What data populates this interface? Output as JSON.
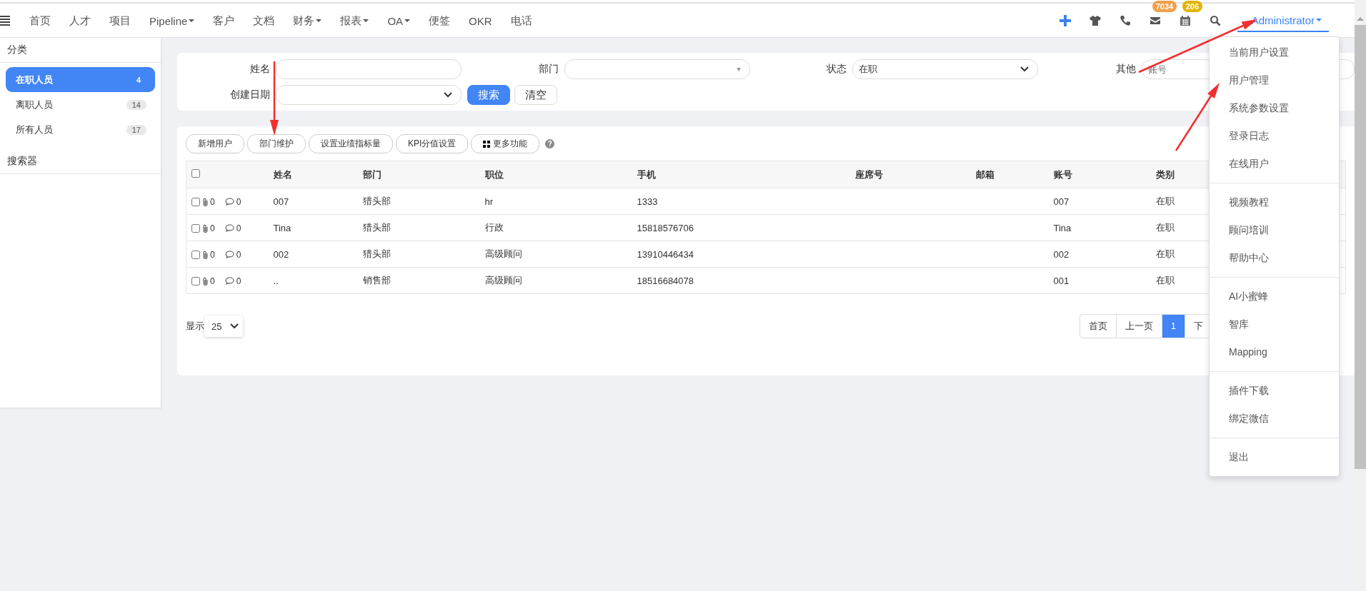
{
  "nav": {
    "items": [
      {
        "label": "首页",
        "dropdown": false
      },
      {
        "label": "人才",
        "dropdown": false
      },
      {
        "label": "项目",
        "dropdown": false
      },
      {
        "label": "Pipeline",
        "dropdown": true
      },
      {
        "label": "客户",
        "dropdown": false
      },
      {
        "label": "文档",
        "dropdown": false
      },
      {
        "label": "财务",
        "dropdown": true
      },
      {
        "label": "报表",
        "dropdown": true
      },
      {
        "label": "OA",
        "dropdown": true
      },
      {
        "label": "便签",
        "dropdown": false
      },
      {
        "label": "OKR",
        "dropdown": false
      },
      {
        "label": "电话",
        "dropdown": false
      }
    ],
    "tools": [
      {
        "kind": "plus"
      },
      {
        "kind": "shirt"
      },
      {
        "kind": "phone"
      },
      {
        "kind": "mail",
        "badge": "7034",
        "color": "#f0a04b"
      },
      {
        "kind": "calendar",
        "badge": "206",
        "color": "#e2b400"
      },
      {
        "kind": "search"
      }
    ],
    "user": {
      "label": "Administrator",
      "expanded": true
    }
  },
  "sidebar": {
    "title": "分类",
    "items": [
      {
        "label": "在职人员",
        "count": "4",
        "selected": true
      },
      {
        "label": "离职人员",
        "count": "14",
        "selected": false
      },
      {
        "label": "所有人员",
        "count": "17",
        "selected": false
      }
    ],
    "section": "搜索器"
  },
  "filters": {
    "fields": [
      {
        "label": "姓名",
        "kind": "input"
      },
      {
        "label": "部门",
        "kind": "combo"
      },
      {
        "label": "状态",
        "kind": "select",
        "value": "在职"
      },
      {
        "label": "其他",
        "kind": "input",
        "placeholder": "账号"
      },
      {
        "label": "创建日期",
        "kind": "select"
      }
    ],
    "buttons": [
      {
        "label": "搜索",
        "primary": true
      },
      {
        "label": "清空",
        "primary": false
      }
    ]
  },
  "toolbar": {
    "buttons": [
      {
        "label": "新增用户",
        "kind": "plain"
      },
      {
        "label": "部门维护",
        "kind": "plain"
      },
      {
        "label": "设置业绩指标量",
        "kind": "plain"
      },
      {
        "label": "KPI分值设置",
        "kind": "plain"
      },
      {
        "label": "更多功能",
        "kind": "grid"
      }
    ],
    "help": "?"
  },
  "table": {
    "all_checked": false,
    "columns": [
      "姓名",
      "部门",
      "职位",
      "手机",
      "座席号",
      "邮箱",
      "账号",
      "类别"
    ],
    "rows": [
      {
        "checked": false,
        "attachments": "0",
        "comments": "0",
        "cells": [
          "007",
          "猎头部",
          "hr",
          "1333",
          "",
          "",
          "007",
          "在职"
        ]
      },
      {
        "checked": false,
        "attachments": "0",
        "comments": "0",
        "cells": [
          "Tina",
          "猎头部",
          "行政",
          "15818576706",
          "",
          "",
          "Tina",
          "在职"
        ]
      },
      {
        "checked": false,
        "attachments": "0",
        "comments": "0",
        "cells": [
          "002",
          "猎头部",
          "高级顾问",
          "13910446434",
          "",
          "",
          "002",
          "在职"
        ]
      },
      {
        "checked": false,
        "attachments": "0",
        "comments": "0",
        "cells": [
          "..",
          "销售部",
          "高级顾问",
          "18516684078",
          "",
          "",
          "001",
          "在职"
        ]
      }
    ]
  },
  "footer": {
    "show_label": "显示",
    "page_size": "25",
    "pages": [
      {
        "label": "首页",
        "selected": false
      },
      {
        "label": "上一页",
        "selected": false
      },
      {
        "label": "1",
        "selected": true
      },
      {
        "label": "下",
        "selected": false
      }
    ]
  },
  "user_menu": {
    "groups": [
      [
        "当前用户设置",
        "用户管理",
        "系统参数设置",
        "登录日志",
        "在线用户"
      ],
      [
        "视频教程",
        "顾问培训",
        "帮助中心"
      ],
      [
        "AI小蜜蜂",
        "智库",
        "Mapping"
      ],
      [
        "插件下载",
        "绑定微信"
      ],
      [
        "退出"
      ]
    ]
  }
}
